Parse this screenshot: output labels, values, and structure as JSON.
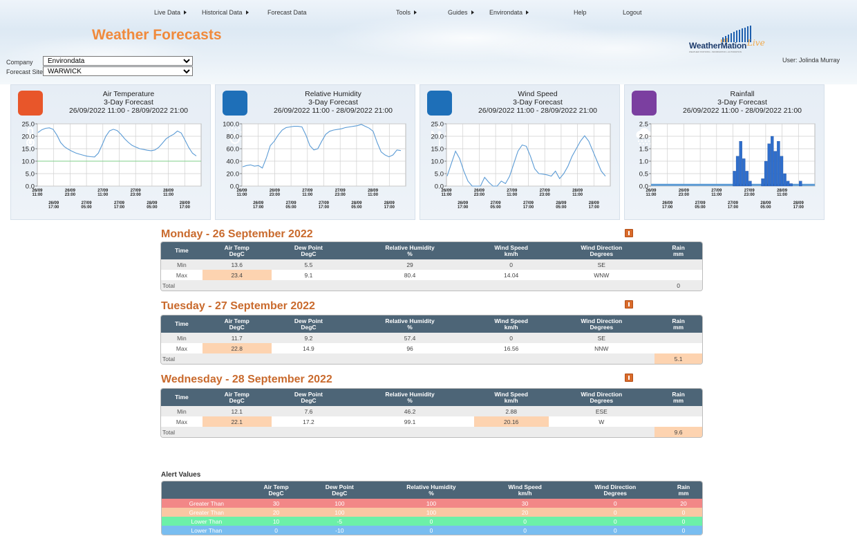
{
  "nav": {
    "items": [
      {
        "label": "Live Data",
        "caret": true
      },
      {
        "label": "Historical Data",
        "caret": true
      },
      {
        "label": "Forecast Data",
        "caret": false
      },
      {
        "label": "Tools",
        "caret": true
      },
      {
        "label": "Guides",
        "caret": true
      },
      {
        "label": "Environdata",
        "caret": true
      },
      {
        "label": "Help",
        "caret": false
      },
      {
        "label": "Logout",
        "caret": false
      }
    ]
  },
  "page_title": "Weather Forecasts",
  "logo": {
    "text": "WeatherMation",
    "live": "Live",
    "tagline": "WEATHER STATIONS • INFORMATION • AUTOMATION"
  },
  "user": "User: Jolinda Murray",
  "filters": {
    "company_label": "Company",
    "company_value": "Environdata",
    "site_label": "Forecast Site",
    "site_value": "WARWICK"
  },
  "chart_data": [
    {
      "type": "line",
      "title": "Air Temperature",
      "subtitle": "3-Day Forecast",
      "range": "26/09/2022 11:00 - 28/09/2022 21:00",
      "icon": "thermometer-icon",
      "icon_color": "#e8562a",
      "ylim": [
        0,
        25
      ],
      "yticks": [
        "0.0",
        "5.0",
        "10.0",
        "15.0",
        "20.0",
        "25.0"
      ],
      "reference_line": 10,
      "y": [
        21.5,
        22.6,
        23.2,
        23.4,
        22.8,
        20.5,
        17.5,
        15.8,
        14.8,
        14.0,
        13.3,
        12.8,
        12.4,
        12.0,
        11.8,
        11.7,
        13.2,
        16.5,
        20.0,
        22.2,
        22.8,
        22.3,
        20.8,
        19.0,
        17.5,
        16.3,
        15.6,
        15.0,
        14.7,
        14.4,
        14.2,
        14.5,
        15.5,
        17.2,
        19.0,
        20.0,
        20.8,
        22.1,
        21.3,
        18.5,
        15.5,
        13.2,
        12.1
      ]
    },
    {
      "type": "line",
      "title": "Relative Humidity",
      "subtitle": "3-Day Forecast",
      "range": "26/09/2022 11:00 - 28/09/2022 21:00",
      "icon": "humidity-icon",
      "icon_color": "#1e6fb8",
      "ylim": [
        0,
        100
      ],
      "yticks": [
        "0.0",
        "20.0",
        "40.0",
        "60.0",
        "80.0",
        "100.0"
      ],
      "y": [
        31,
        33,
        34,
        32,
        33,
        29,
        45,
        65,
        72,
        82,
        90,
        94,
        95,
        96,
        96,
        95,
        82,
        65,
        58,
        60,
        72,
        83,
        88,
        90,
        91,
        92,
        94,
        95,
        96,
        97,
        99,
        96,
        93,
        88,
        70,
        55,
        50,
        47,
        50,
        58,
        57
      ]
    },
    {
      "type": "line",
      "title": "Wind Speed",
      "subtitle": "3-Day Forecast",
      "range": "26/09/2022 11:00 - 28/09/2022 21:00",
      "icon": "wind-icon",
      "icon_color": "#1e6fb8",
      "ylim": [
        0,
        25
      ],
      "yticks": [
        "0.0",
        "5.0",
        "10.0",
        "15.0",
        "20.0",
        "25.0"
      ],
      "y": [
        4,
        9,
        14.0,
        11,
        6,
        2,
        0,
        0,
        0,
        3.5,
        1.5,
        0,
        0,
        2,
        1,
        4,
        9,
        14,
        16.5,
        16,
        12,
        7,
        5,
        4.8,
        4.5,
        4,
        6,
        3,
        5,
        8,
        12,
        15,
        18,
        20.2,
        18,
        14,
        10,
        6,
        4
      ]
    },
    {
      "type": "bar",
      "title": "Rainfall",
      "subtitle": "3-Day Forecast",
      "range": "26/09/2022 11:00 - 28/09/2022 21:00",
      "icon": "rain-cloud-icon",
      "icon_color": "#7b3fa0",
      "ylim": [
        0,
        2.5
      ],
      "yticks": [
        "0.0",
        "0.5",
        "1.0",
        "1.5",
        "2.0",
        "2.5"
      ],
      "bars": [
        {
          "i": 26,
          "v": 0.6
        },
        {
          "i": 27,
          "v": 1.2
        },
        {
          "i": 28,
          "v": 1.8
        },
        {
          "i": 29,
          "v": 1.1
        },
        {
          "i": 30,
          "v": 0.6
        },
        {
          "i": 31,
          "v": 0.2
        },
        {
          "i": 35,
          "v": 0.3
        },
        {
          "i": 36,
          "v": 1.0
        },
        {
          "i": 37,
          "v": 1.7
        },
        {
          "i": 38,
          "v": 2.0
        },
        {
          "i": 39,
          "v": 1.4
        },
        {
          "i": 40,
          "v": 1.8
        },
        {
          "i": 41,
          "v": 1.2
        },
        {
          "i": 42,
          "v": 0.5
        },
        {
          "i": 43,
          "v": 0.2
        },
        {
          "i": 44,
          "v": 0.1
        },
        {
          "i": 47,
          "v": 0.2
        }
      ],
      "n": 52
    }
  ],
  "x_ticks_top": [
    [
      "26/09",
      "11:00"
    ],
    [
      "26/09",
      "23:00"
    ],
    [
      "27/09",
      "11:00"
    ],
    [
      "27/09",
      "23:00"
    ],
    [
      "28/09",
      "11:00"
    ]
  ],
  "x_ticks_bottom": [
    [
      "26/09",
      "17:00"
    ],
    [
      "27/09",
      "05:00"
    ],
    [
      "27/09",
      "17:00"
    ],
    [
      "28/09",
      "05:00"
    ],
    [
      "28/09",
      "17:00"
    ]
  ],
  "table_headers": [
    [
      "Time",
      ""
    ],
    [
      "Air Temp",
      "DegC"
    ],
    [
      "Dew Point",
      "DegC"
    ],
    [
      "Relative Humidity",
      "%"
    ],
    [
      "Wind Speed",
      "km/h"
    ],
    [
      "Wind Direction",
      "Degrees"
    ],
    [
      "Rain",
      "mm"
    ]
  ],
  "days": [
    {
      "heading": "Monday - 26 September 2022",
      "rows": [
        {
          "label": "Min",
          "vals": [
            "13.6",
            "5.5",
            "29",
            "0",
            "SE",
            ""
          ],
          "hl": []
        },
        {
          "label": "Max",
          "vals": [
            "23.4",
            "9.1",
            "80.4",
            "14.04",
            "WNW",
            ""
          ],
          "hl": [
            0
          ]
        },
        {
          "label": "Total",
          "vals": [
            "",
            "",
            "",
            "",
            "",
            "0"
          ],
          "hl": []
        }
      ]
    },
    {
      "heading": "Tuesday - 27 September 2022",
      "rows": [
        {
          "label": "Min",
          "vals": [
            "11.7",
            "9.2",
            "57.4",
            "0",
            "SE",
            ""
          ],
          "hl": []
        },
        {
          "label": "Max",
          "vals": [
            "22.8",
            "14.9",
            "96",
            "16.56",
            "NNW",
            ""
          ],
          "hl": [
            0
          ]
        },
        {
          "label": "Total",
          "vals": [
            "",
            "",
            "",
            "",
            "",
            "5.1"
          ],
          "hl": [
            5
          ]
        }
      ]
    },
    {
      "heading": "Wednesday - 28 September 2022",
      "rows": [
        {
          "label": "Min",
          "vals": [
            "12.1",
            "7.6",
            "46.2",
            "2.88",
            "ESE",
            ""
          ],
          "hl": []
        },
        {
          "label": "Max",
          "vals": [
            "22.1",
            "17.2",
            "99.1",
            "20.16",
            "W",
            ""
          ],
          "hl": [
            0,
            3
          ]
        },
        {
          "label": "Total",
          "vals": [
            "",
            "",
            "",
            "",
            "",
            "9.6"
          ],
          "hl": [
            5
          ]
        }
      ]
    }
  ],
  "alerts": {
    "title": "Alert Values",
    "rows": [
      {
        "label": "Greater Than",
        "vals": [
          "30",
          "100",
          "100",
          "30",
          "0",
          "20"
        ],
        "color": "#f28787"
      },
      {
        "label": "Greater Than",
        "vals": [
          "20",
          "100",
          "100",
          "20",
          "0",
          "0"
        ],
        "color": "#f9c7a3"
      },
      {
        "label": "Lower Than",
        "vals": [
          "10",
          "-5",
          "0",
          "0",
          "0",
          "0"
        ],
        "color": "#6cf0a8"
      },
      {
        "label": "Lower Than",
        "vals": [
          "0",
          "-10",
          "0",
          "0",
          "0",
          "0"
        ],
        "color": "#79bdf0"
      }
    ]
  }
}
